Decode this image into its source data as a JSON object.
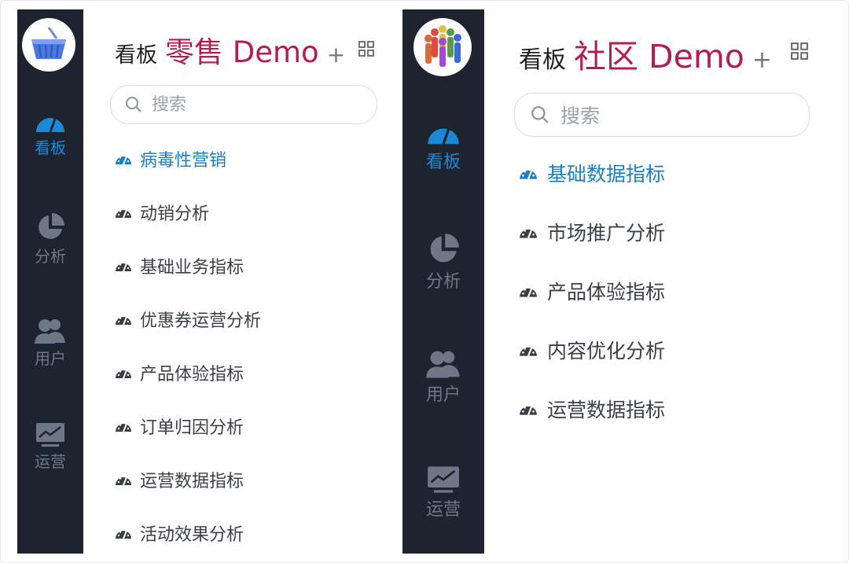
{
  "left_panel": {
    "sidebar": {
      "nav": [
        {
          "label": "看板",
          "icon": "gauge-icon",
          "active": true
        },
        {
          "label": "分析",
          "icon": "pie-chart-icon",
          "active": false
        },
        {
          "label": "用户",
          "icon": "users-icon",
          "active": false
        },
        {
          "label": "运营",
          "icon": "monitor-chart-icon",
          "active": false
        }
      ]
    },
    "header": {
      "label": "看板",
      "title": "零售 Demo",
      "plus": "+"
    },
    "search": {
      "placeholder": "搜索"
    },
    "menu": [
      {
        "label": "病毒性营销",
        "active": true
      },
      {
        "label": "动销分析",
        "active": false
      },
      {
        "label": "基础业务指标",
        "active": false
      },
      {
        "label": "优惠券运营分析",
        "active": false
      },
      {
        "label": "产品体验指标",
        "active": false
      },
      {
        "label": "订单归因分析",
        "active": false
      },
      {
        "label": "运营数据指标",
        "active": false
      },
      {
        "label": "活动效果分析",
        "active": false
      }
    ]
  },
  "right_panel": {
    "sidebar": {
      "nav": [
        {
          "label": "看板",
          "icon": "gauge-icon",
          "active": true
        },
        {
          "label": "分析",
          "icon": "pie-chart-icon",
          "active": false
        },
        {
          "label": "用户",
          "icon": "users-icon",
          "active": false
        },
        {
          "label": "运营",
          "icon": "monitor-chart-icon",
          "active": false
        }
      ]
    },
    "header": {
      "label": "看板",
      "title": "社区 Demo",
      "plus": "+"
    },
    "search": {
      "placeholder": "搜索"
    },
    "menu": [
      {
        "label": "基础数据指标",
        "active": true
      },
      {
        "label": "市场推广分析",
        "active": false
      },
      {
        "label": "产品体验指标",
        "active": false
      },
      {
        "label": "内容优化分析",
        "active": false
      },
      {
        "label": "运营数据指标",
        "active": false
      }
    ]
  },
  "colors": {
    "sidebar_bg": "#1d2430",
    "active_blue": "#1b8ad6",
    "title_crimson": "#b21f4f",
    "inactive_icon": "#6d7787"
  }
}
